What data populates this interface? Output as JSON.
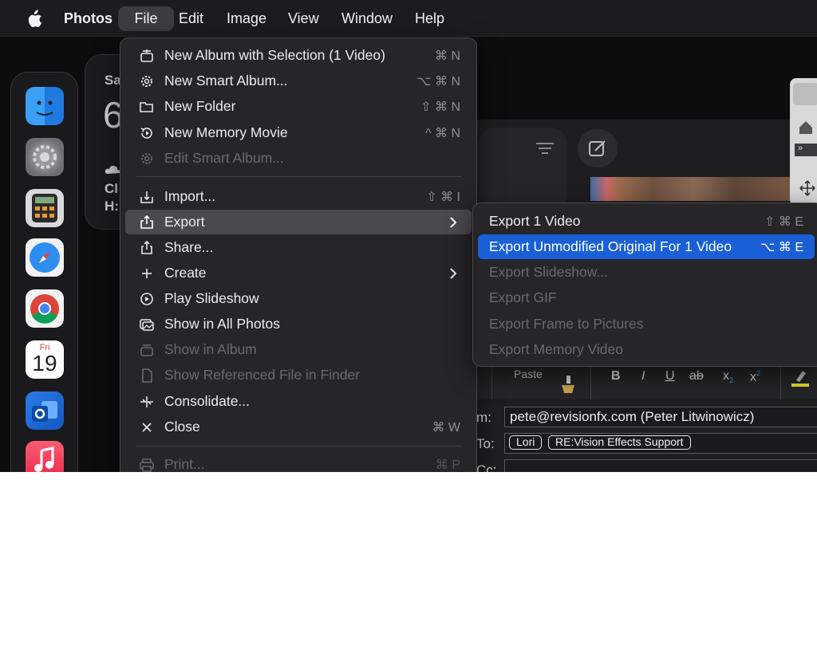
{
  "menubar": {
    "app_name": "Photos",
    "items": [
      "File",
      "Edit",
      "Image",
      "View",
      "Window",
      "Help"
    ]
  },
  "background": {
    "widget_lines": [
      "Sa",
      "6",
      "Cl",
      "H:"
    ],
    "mail_toolbar": {
      "paste_label": "Paste",
      "bold": "B",
      "italic": "I",
      "underline": "U",
      "strike": "ab",
      "subscript": "x",
      "superscript": "x"
    },
    "mail_header": {
      "from_label": "m:",
      "from_value": "pete@revisionfx.com (Peter Litwinowicz)",
      "to_label": "To:",
      "to_chips": [
        "Lori",
        "RE:Vision Effects Support"
      ],
      "cc_label": "Cc:"
    },
    "calendar_icon": {
      "month": "Fri",
      "day": "19"
    }
  },
  "file_menu": {
    "items": [
      {
        "label": "New Album with Selection (1 Video)",
        "shortcut": "⌘ N",
        "icon": "album-add-icon"
      },
      {
        "label": "New Smart Album...",
        "shortcut": "⌥ ⌘ N",
        "icon": "gear-icon"
      },
      {
        "label": "New Folder",
        "shortcut": "⇧ ⌘ N",
        "icon": "folder-icon"
      },
      {
        "label": "New Memory Movie",
        "shortcut": "^ ⌘ N",
        "icon": "memory-icon"
      },
      {
        "label": "Edit Smart Album...",
        "shortcut": "",
        "icon": "gear-icon"
      },
      {
        "label": "Import...",
        "shortcut": "⇧ ⌘ I",
        "icon": "import-icon"
      },
      {
        "label": "Export",
        "shortcut": "",
        "icon": "export-icon"
      },
      {
        "label": "Share...",
        "shortcut": "",
        "icon": "share-icon"
      },
      {
        "label": "Create",
        "shortcut": "",
        "icon": "plus-icon"
      },
      {
        "label": "Play Slideshow",
        "shortcut": "",
        "icon": "play-icon"
      },
      {
        "label": "Show in All Photos",
        "shortcut": "",
        "icon": "photos-icon"
      },
      {
        "label": "Show in Album",
        "shortcut": "",
        "icon": "album-icon"
      },
      {
        "label": "Show Referenced File in Finder",
        "shortcut": "",
        "icon": "file-icon"
      },
      {
        "label": "Consolidate...",
        "shortcut": "",
        "icon": "consolidate-icon"
      },
      {
        "label": "Close",
        "shortcut": "⌘ W",
        "icon": "close-icon"
      },
      {
        "label": "Print...",
        "shortcut": "⌘ P",
        "icon": "print-icon"
      }
    ]
  },
  "export_submenu": {
    "items": [
      {
        "label": "Export 1 Video",
        "shortcut": "⇧ ⌘ E"
      },
      {
        "label": "Export Unmodified Original For 1 Video",
        "shortcut": "⌥ ⌘ E"
      },
      {
        "label": "Export Slideshow...",
        "shortcut": ""
      },
      {
        "label": "Export GIF",
        "shortcut": ""
      },
      {
        "label": "Export Frame to Pictures",
        "shortcut": ""
      },
      {
        "label": "Export Memory Video",
        "shortcut": ""
      }
    ]
  },
  "colors": {
    "selection": "#1a5fd6",
    "menu_bg": "#262628",
    "menubar_bg": "#1c1c1e"
  }
}
